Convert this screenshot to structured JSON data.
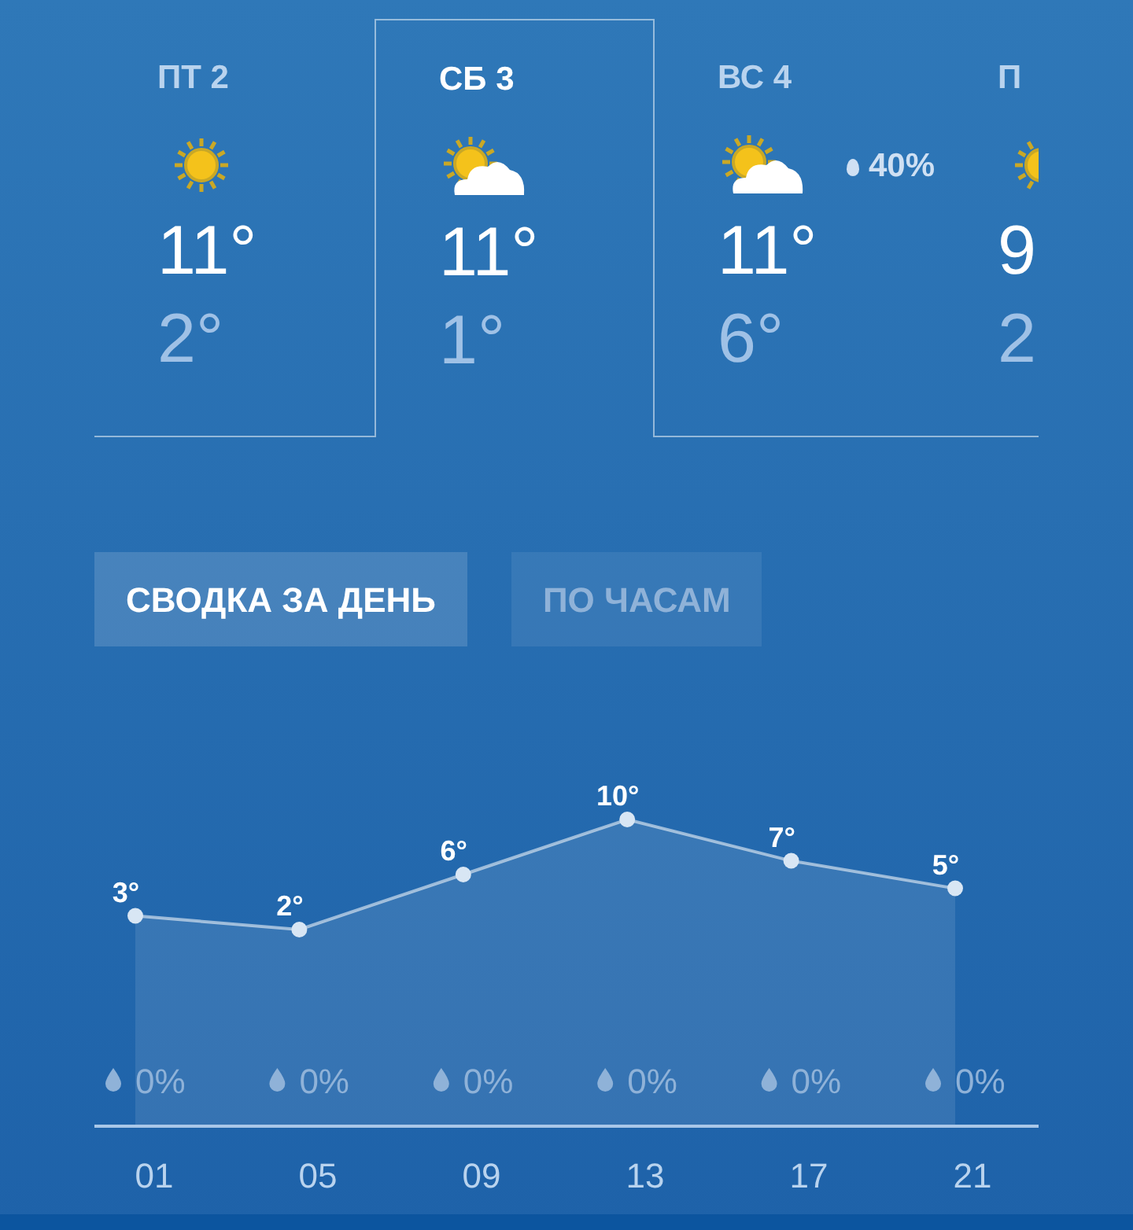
{
  "days": [
    {
      "day": "ПТ 2",
      "kind": "sun",
      "high": "11°",
      "low": "2°",
      "selected": false
    },
    {
      "day": "СБ 3",
      "kind": "partly_cloudy",
      "high": "11°",
      "low": "1°",
      "selected": true
    },
    {
      "day": "ВС 4",
      "kind": "partly_cloudy",
      "high": "11°",
      "low": "6°",
      "precip": "40%",
      "selected": false
    },
    {
      "day": "П",
      "kind": "sun",
      "high": "9",
      "low": "2",
      "selected": false
    }
  ],
  "view_tabs": [
    {
      "label": "СВОДКА ЗА ДЕНЬ",
      "selected": true
    },
    {
      "label": "ПО ЧАСАМ",
      "selected": false
    }
  ],
  "hourly": {
    "chart_data": {
      "type": "area",
      "categories": [
        "01",
        "05",
        "09",
        "13",
        "17",
        "21"
      ],
      "series": [
        {
          "color": "#ffffff",
          "values": [
            3,
            2,
            6,
            10,
            7,
            5
          ],
          "value_labels": [
            "3°",
            "2°",
            "6°",
            "10°",
            "7°",
            "5°"
          ]
        }
      ]
    },
    "precipitation": [
      "0%",
      "0%",
      "0%",
      "0%",
      "0%",
      "0%"
    ]
  }
}
